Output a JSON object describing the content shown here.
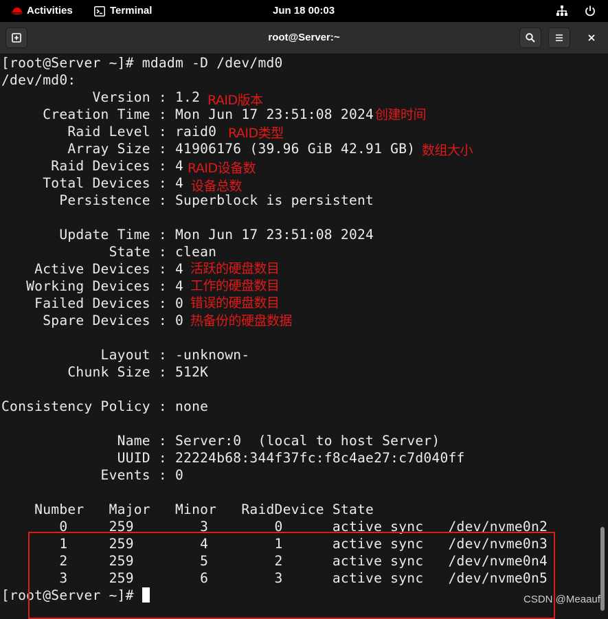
{
  "topbar": {
    "activities": "Activities",
    "app": "Terminal",
    "clock": "Jun 18  00:03"
  },
  "window": {
    "title": "root@Server:~"
  },
  "terminal": {
    "lines": [
      "[root@Server ~]# mdadm -D /dev/md0",
      "/dev/md0:",
      "           Version : 1.2",
      "     Creation Time : Mon Jun 17 23:51:08 2024",
      "        Raid Level : raid0",
      "        Array Size : 41906176 (39.96 GiB 42.91 GB)",
      "      Raid Devices : 4",
      "     Total Devices : 4",
      "       Persistence : Superblock is persistent",
      "",
      "       Update Time : Mon Jun 17 23:51:08 2024",
      "             State : clean",
      "    Active Devices : 4",
      "   Working Devices : 4",
      "    Failed Devices : 0",
      "     Spare Devices : 0",
      "",
      "            Layout : -unknown-",
      "        Chunk Size : 512K",
      "",
      "Consistency Policy : none",
      "",
      "              Name : Server:0  (local to host Server)",
      "              UUID : 22224b68:344f37fc:f8c4ae27:c7d040ff",
      "            Events : 0",
      "",
      "    Number   Major   Minor   RaidDevice State",
      "       0     259        3        0      active sync   /dev/nvme0n2",
      "       1     259        4        1      active sync   /dev/nvme0n3",
      "       2     259        5        2      active sync   /dev/nvme0n4",
      "       3     259        6        3      active sync   /dev/nvme0n5"
    ],
    "prompt": "[root@Server ~]# "
  },
  "annotations": [
    "RAID版本",
    "创建时间",
    "RAID类型",
    "数组大小",
    "RAID设备数",
    "设备总数",
    "活跃的硬盘数目",
    "工作的硬盘数目",
    "错误的硬盘数目",
    "热备份的硬盘数据"
  ],
  "watermark": "CSDN @Meaauf",
  "colors": {
    "annotation": "#e11919",
    "terminal_bg": "#171717",
    "text": "#ececec",
    "box": "#d81e1e"
  },
  "icons": [
    "redhat-logo-icon",
    "terminal-icon",
    "network-icon",
    "power-icon",
    "new-tab-icon",
    "search-icon",
    "menu-icon",
    "close-icon"
  ]
}
